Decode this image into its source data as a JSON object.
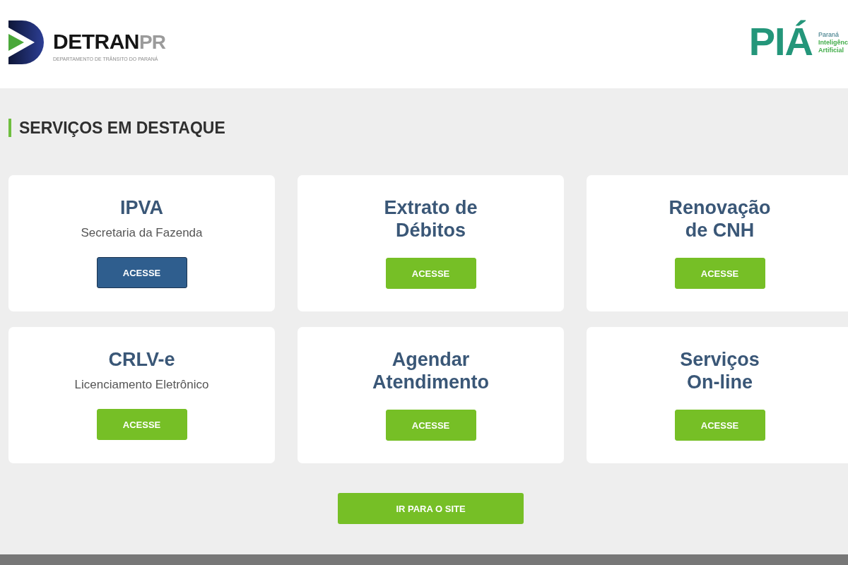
{
  "header": {
    "logo": {
      "name": "DETRAN",
      "suffix": "PR",
      "subtitle": "DEPARTAMENTO DE TRÂNSITO DO PARANÁ"
    },
    "partner_logo": {
      "name": "PIÁ",
      "lines": [
        "Paraná",
        "Inteligênc",
        "Artificial"
      ]
    }
  },
  "section": {
    "title": "SERVIÇOS EM DESTAQUE"
  },
  "services": [
    {
      "title": "IPVA",
      "subtitle": "Secretaria da Fazenda",
      "button": {
        "label": "ACESSE",
        "selected": true
      }
    },
    {
      "title": "Extrato de\nDébitos",
      "button": {
        "label": "ACESSE",
        "selected": false
      }
    },
    {
      "title": "Renovação\nde CNH",
      "button": {
        "label": "ACESSE",
        "selected": false
      }
    },
    {
      "title": "CRLV-e",
      "subtitle": "Licenciamento Eletrônico",
      "button": {
        "label": "ACESSE",
        "selected": false
      }
    },
    {
      "title": "Agendar\nAtendimento",
      "button": {
        "label": "ACESSE",
        "selected": false
      }
    },
    {
      "title": "Serviços\nOn-line",
      "button": {
        "label": "ACESSE",
        "selected": false
      }
    }
  ],
  "site_button": {
    "label": "IR PARA O SITE"
  }
}
